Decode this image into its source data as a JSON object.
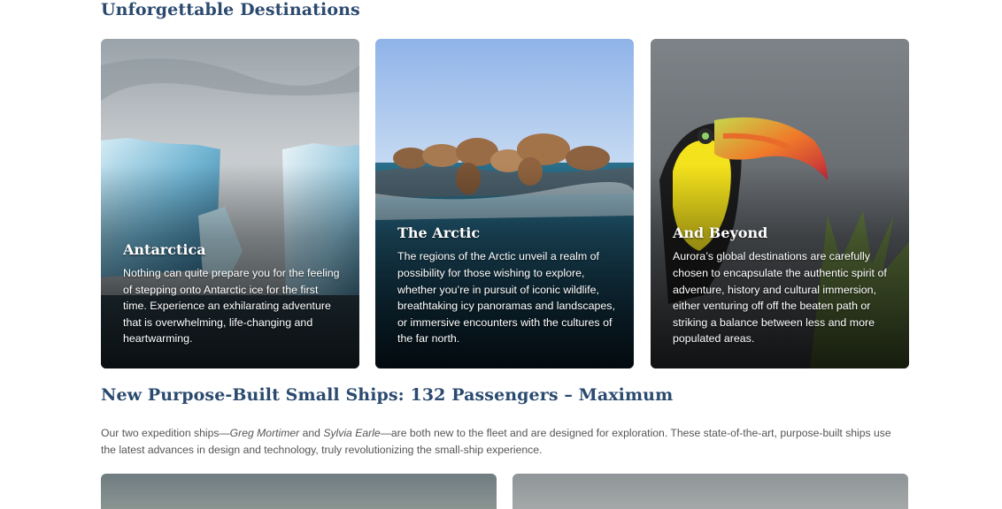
{
  "section1": {
    "heading": "Unforgettable Destinations"
  },
  "cards": [
    {
      "title": "Antarctica",
      "text": "Nothing can quite prepare you for the feeling of stepping onto Antarctic ice for the first time. Experience an exhilarating adventure that is overwhelming, life-changing and heartwarming."
    },
    {
      "title": "The Arctic",
      "text": "The regions of the Arctic unveil a realm of possibility for those wishing to explore, whether you’re in pursuit of iconic wildlife, breathtaking icy panoramas and landscapes, or immersive encounters with the cultures of the far north."
    },
    {
      "title": "And Beyond",
      "text": "Aurora’s global destinations are carefully chosen to encapsulate the authentic spirit of adventure, history and cultural immersion, either venturing off off the beaten path or striking a balance between less and more populated areas."
    }
  ],
  "section2": {
    "heading": "New Purpose-Built Small Ships: 132 Passengers – Maximum",
    "intro_before": "Our two expedition ships—",
    "ship1": "Greg Mortimer",
    "and": " and ",
    "ship2": "Sylvia Earle",
    "intro_after": "—are both new to the fleet and are designed for exploration. These state-of-the-art, purpose-built ships use the latest advances in design and technology, truly revolutionizing the small-ship experience."
  }
}
